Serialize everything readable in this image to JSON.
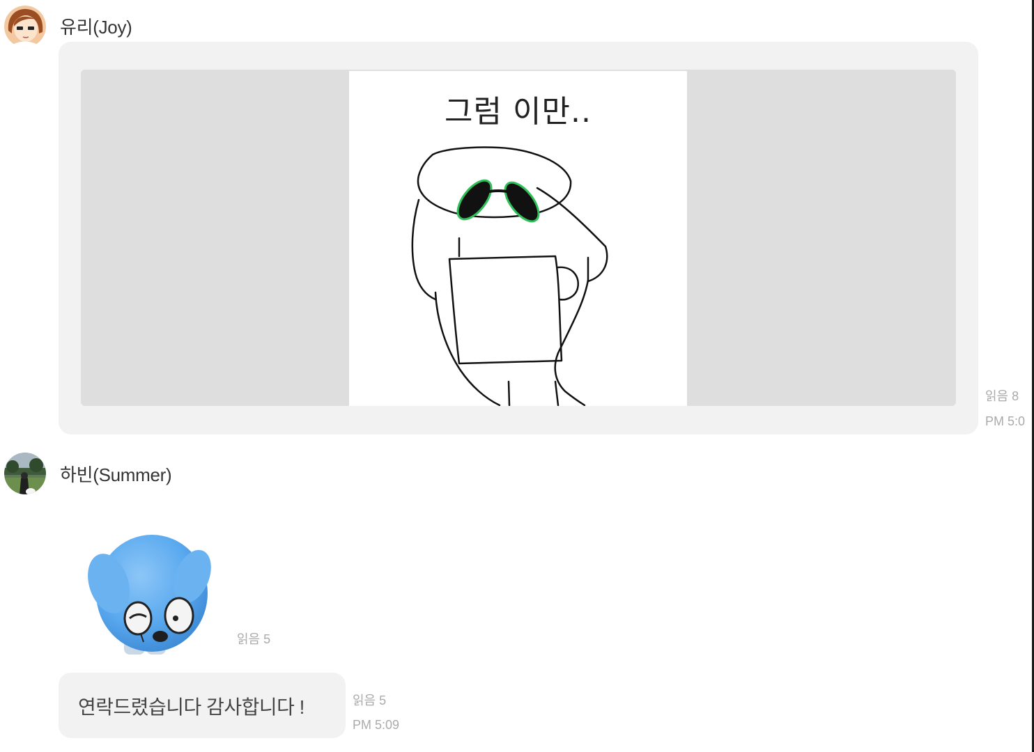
{
  "messages": [
    {
      "sender": "유리(Joy)",
      "read_label": "읽음 8",
      "time": "PM 5:0",
      "image_text": "그럼 이만.."
    },
    {
      "sender": "하빈(Summer)",
      "sticker_read_label": "읽음 5",
      "text": "연락드렸습니다 감사합니다 !",
      "read_label": "읽음 5",
      "time": "PM 5:09"
    }
  ],
  "colors": {
    "bubble": "#f2f2f2",
    "image_letterbox": "#dedede",
    "meta_text": "#aaaaaa",
    "sticker_blue": "#5aa9ef"
  },
  "icons": {
    "joy_avatar": "cartoon-girl-avatar",
    "summer_avatar": "photo-avatar",
    "sticker": "blue-dog-sticker"
  }
}
